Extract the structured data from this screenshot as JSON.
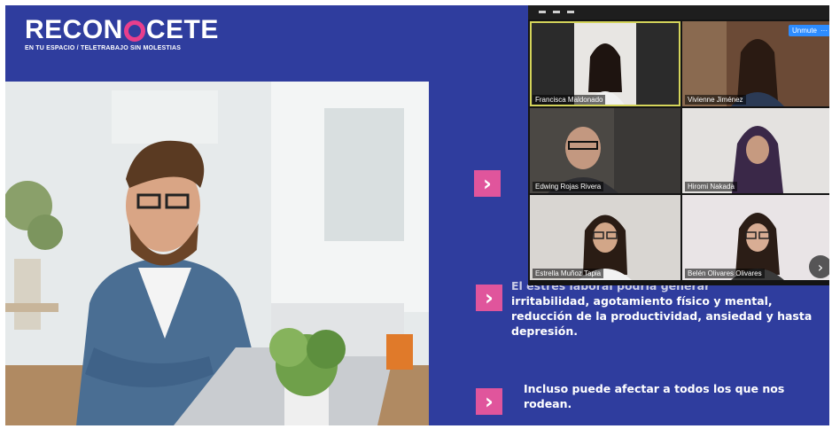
{
  "brand": {
    "title_part1": "RECON",
    "title_part2": "CETE",
    "subtitle": "EN TU ESPACIO / TELETRABAJO SIN MOLESTIAS",
    "accent": "#e83e8c"
  },
  "slide": {
    "background": "#2f3d9e",
    "bullets": [
      {
        "icon": "chevron-right-icon",
        "text": ""
      },
      {
        "icon": "chevron-right-icon",
        "text_faded": "El estrés laboral podría generar",
        "text": "irritabilidad, agotamiento físico y mental, reducción de la productividad, ansiedad y hasta depresión."
      },
      {
        "icon": "chevron-right-icon",
        "text": "Incluso puede afectar a todos los que nos rodean."
      }
    ]
  },
  "zoom": {
    "unmute_label": "Unmute",
    "more_label": "···",
    "next_icon": "chevron-right-icon",
    "participants": [
      {
        "name": "Francisca Maldonado",
        "active": true
      },
      {
        "name": "Vivienne Jiménez"
      },
      {
        "name": "Edwing Rojas Rivera"
      },
      {
        "name": "Hiromi Nakada"
      },
      {
        "name": "Estrella Muñoz Tapia"
      },
      {
        "name": "Belén Olivares Olivares"
      }
    ]
  }
}
